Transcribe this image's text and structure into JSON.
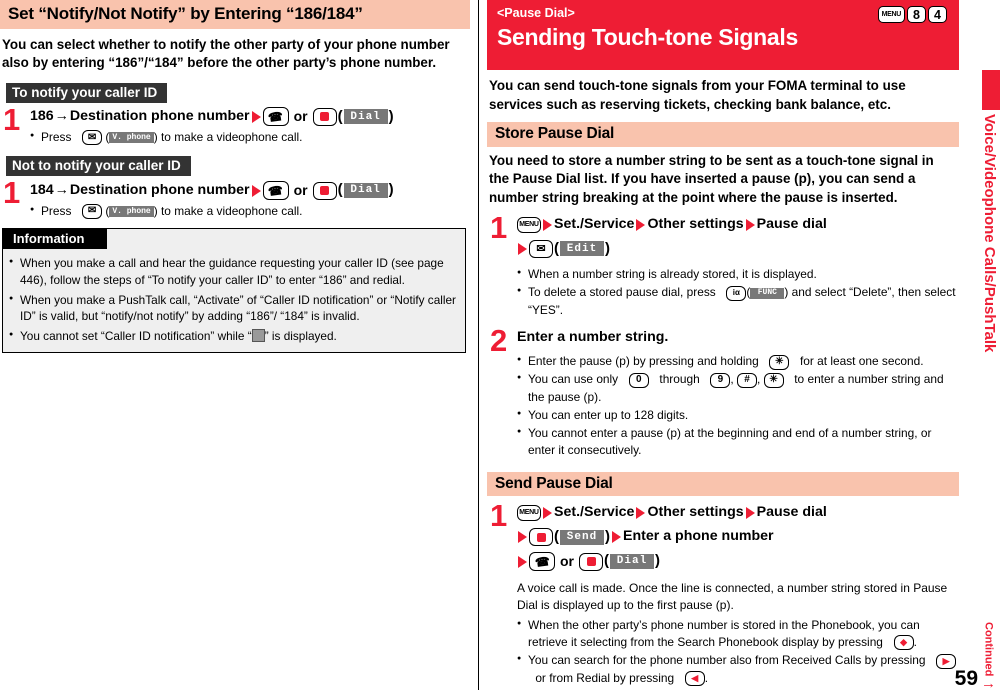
{
  "left": {
    "header": "Set “Notify/Not Notify” by Entering “186/184”",
    "lead": "You can select whether to notify the other party of your phone number also by entering “186”/“184” before the other party’s phone number.",
    "sections": [
      {
        "label": "To notify your caller ID",
        "step_num": "1",
        "prefix": "186",
        "arrow_char": "→",
        "main": "Destination phone number",
        "or_label": "or",
        "dial_button": "Dial",
        "note_press": "Press",
        "note_btn": "V. phone",
        "note_tail": ") to make a videophone call."
      },
      {
        "label": "Not to notify your caller ID",
        "step_num": "1",
        "prefix": "184",
        "arrow_char": "→",
        "main": "Destination phone number",
        "or_label": "or",
        "dial_button": "Dial",
        "note_press": "Press",
        "note_btn": "V. phone",
        "note_tail": ") to make a videophone call."
      }
    ],
    "information": {
      "label": "Information",
      "items": [
        "When you make a call and hear the guidance requesting your caller ID (see page 446), follow the steps of “To notify your caller ID” to enter “186” and redial.",
        "When you make a PushTalk call, “Activate” of “Caller ID notification” or “Notify caller ID” is valid, but “notify/not notify” by adding “186”/ “184” is invalid.",
        "You cannot set “Caller ID notification” while “"
      ],
      "item3_tail": "” is displayed."
    }
  },
  "right": {
    "banner": {
      "tag": "<Pause Dial>",
      "title": "Sending Touch-tone Signals",
      "keys": [
        "MENU",
        "8",
        "4"
      ]
    },
    "lead": "You can send touch-tone signals from your FOMA terminal to use services such as reserving tickets, checking bank balance, etc.",
    "store": {
      "header": "Store Pause Dial",
      "lead": "You need to store a number string to be sent as a touch-tone signal in the Pause Dial list. If you have inserted a pause (p), you can send a number string breaking at the point where the pause is inserted.",
      "step1": {
        "num": "1",
        "menu_key": "MENU",
        "nav": [
          "Set./Service",
          "Other settings",
          "Pause dial"
        ],
        "edit_button": "Edit",
        "notes": [
          "When a number string is already stored, it is displayed.",
          "To delete a stored pause dial, press"
        ],
        "func_button": "FUNC",
        "note2_tail": ") and select “Delete”, then select “YES”."
      },
      "step2": {
        "num": "2",
        "title": "Enter a number string.",
        "note1_head": "Enter the pause (p) by pressing and holding",
        "note1_tail": "for at least one second.",
        "note2_head": "You can use only",
        "note2_mid": "through",
        "note2_tail": "to enter a number string and the pause (p).",
        "keys": [
          "0",
          "9",
          "#",
          "✳"
        ],
        "note3": "You can enter up to 128 digits.",
        "note4": "You cannot enter a pause (p) at the beginning and end of a number string, or enter it consecutively."
      }
    },
    "send": {
      "header": "Send Pause Dial",
      "step1": {
        "num": "1",
        "menu_key": "MENU",
        "nav": [
          "Set./Service",
          "Other settings",
          "Pause dial"
        ],
        "send_button": "Send",
        "enter_phone": "Enter a phone number",
        "or_label": "or",
        "dial_button": "Dial"
      },
      "desc": "A voice call is made. Once the line is connected, a number string stored in Pause Dial is displayed up to the first pause (p).",
      "notes": [
        "When the other party’s phone number is stored in the Phonebook, you can retrieve it selecting from the Search Phonebook display by pressing",
        "You can search for the phone number also from Received Calls by pressing",
        "or from Redial by pressing"
      ]
    }
  },
  "side_tab": {
    "text": "Voice/Videophone Calls/PushTalk"
  },
  "footer": {
    "page": "59",
    "continued": "Continued",
    "arrow": "→"
  },
  "colors": {
    "accent_red": "#ee1d34",
    "peach": "#f9c3ad",
    "gray_button": "#787878",
    "info_bg": "#efefef"
  }
}
